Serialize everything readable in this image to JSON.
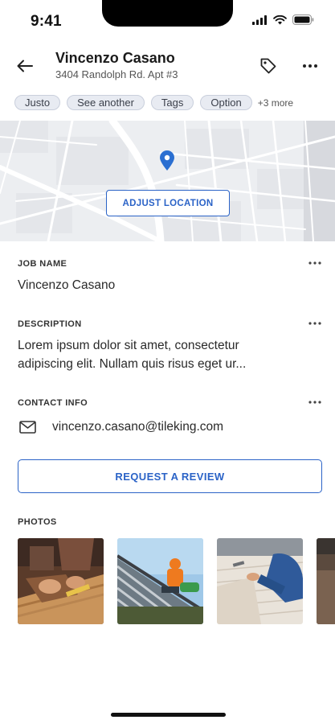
{
  "status_bar": {
    "time": "9:41"
  },
  "header": {
    "title": "Vincenzo Casano",
    "subtitle": "3404 Randolph Rd. Apt #3"
  },
  "tags": {
    "items": [
      "Justo",
      "See another",
      "Tags",
      "Option"
    ],
    "more_label": "+3 more"
  },
  "map": {
    "adjust_label": "ADJUST LOCATION"
  },
  "job_name": {
    "label": "JOB NAME",
    "value": "Vincenzo Casano"
  },
  "description": {
    "label": "DESCRIPTION",
    "line1": "Lorem ipsum dolor sit amet, consectetur",
    "line2": "adipiscing elit. Nullam quis risus eget ur..."
  },
  "contact": {
    "label": "CONTACT INFO",
    "email": "vincenzo.casano@tileking.com"
  },
  "review_button": "REQUEST A REVIEW",
  "photos": {
    "label": "PHOTOS"
  },
  "colors": {
    "accent": "#2b63c7",
    "chip_bg": "#e8ebf2",
    "map_bg": "#eceef1"
  },
  "icons": [
    "back-arrow-icon",
    "tag-icon",
    "more-horizontal-icon",
    "map-pin-icon",
    "mail-icon"
  ]
}
